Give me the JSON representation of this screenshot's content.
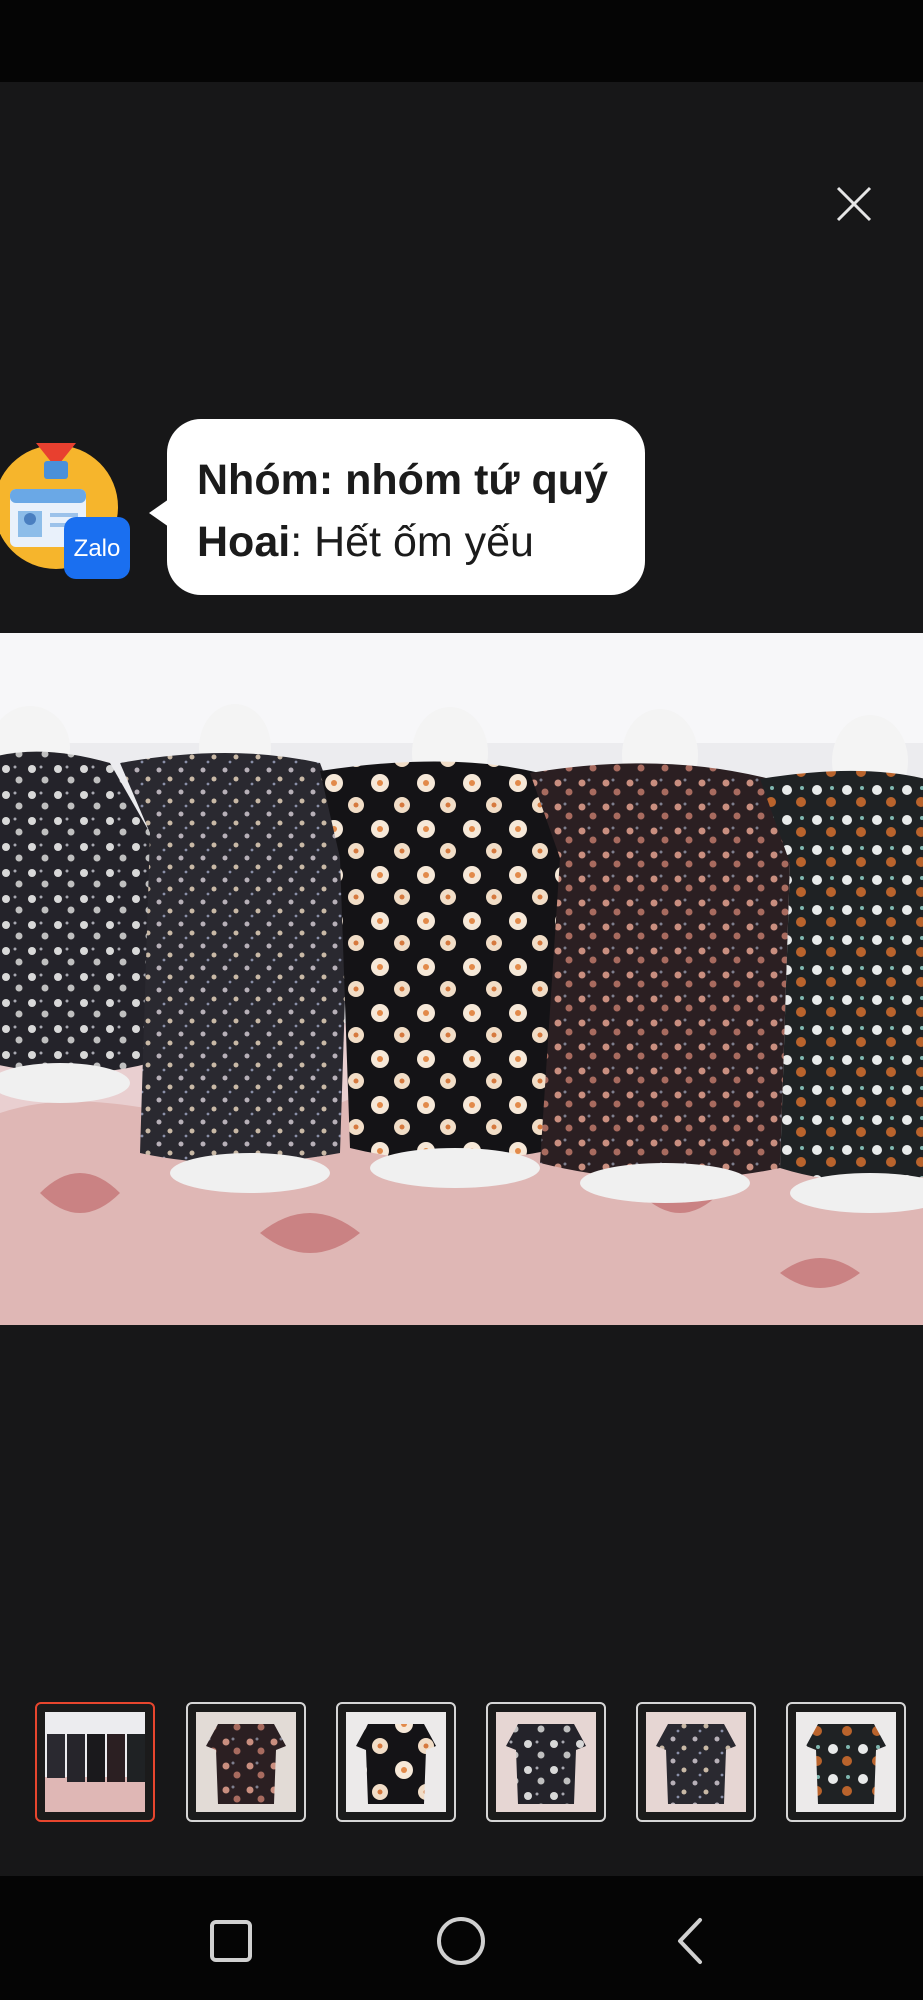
{
  "notification": {
    "app_icon": "zalo-app-icon",
    "badge_text": "Zalo",
    "group_label": "Nhóm:",
    "group_name": " nhóm tứ quý",
    "sender": "Hoai",
    "message": ": Hết ốm yếu"
  },
  "viewer": {
    "close_icon": "close-icon",
    "main_image": "photo of five floral print blouses displayed on white mannequin forms",
    "thumbnails": [
      {
        "icon": "thumbnail-group-photo",
        "selected": true
      },
      {
        "icon": "thumbnail-blouse-2",
        "selected": false
      },
      {
        "icon": "thumbnail-blouse-3",
        "selected": false
      },
      {
        "icon": "thumbnail-blouse-4",
        "selected": false
      },
      {
        "icon": "thumbnail-blouse-5",
        "selected": false
      },
      {
        "icon": "thumbnail-blouse-6",
        "selected": false
      }
    ]
  },
  "navigation": {
    "recents_icon": "square-icon",
    "home_icon": "circle-icon",
    "back_icon": "back-chevron-icon"
  },
  "colors": {
    "background": "#171718",
    "bars": "#050505",
    "selected_thumb_border": "#e8462e",
    "zalo_blue": "#1a6ff0"
  }
}
